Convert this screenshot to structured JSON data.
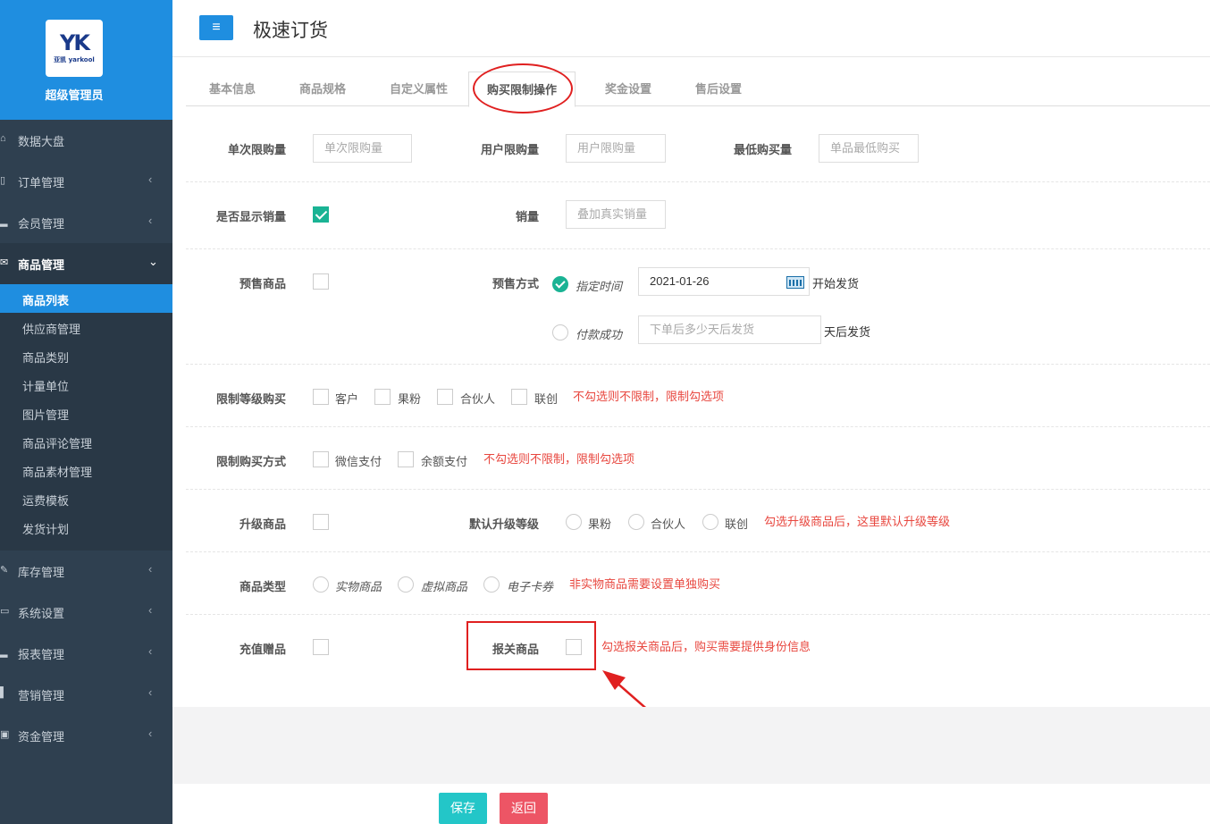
{
  "sidebar": {
    "brand_mark": "YK",
    "brand_text": "亚凯 yarkool",
    "admin_label": "超级管理员",
    "items": [
      {
        "label": "数据大盘",
        "icon": "home-icon"
      },
      {
        "label": "订单管理",
        "icon": "order-icon"
      },
      {
        "label": "会员管理",
        "icon": "bar-chart-icon"
      },
      {
        "label": "商品管理",
        "icon": "envelope-icon"
      },
      {
        "label": "库存管理",
        "icon": "edit-icon"
      },
      {
        "label": "系统设置",
        "icon": "monitor-icon"
      },
      {
        "label": "报表管理",
        "icon": "bar-chart-icon"
      },
      {
        "label": "营销管理",
        "icon": "bars-icon"
      },
      {
        "label": "资金管理",
        "icon": "money-icon"
      }
    ],
    "sub_items": [
      "商品列表",
      "供应商管理",
      "商品类别",
      "计量单位",
      "图片管理",
      "商品评论管理",
      "商品素材管理",
      "运费模板",
      "发货计划"
    ],
    "active_sub": "商品列表"
  },
  "header": {
    "menu_icon": "≡",
    "title": "极速订货"
  },
  "tabs": [
    "基本信息",
    "商品规格",
    "自定义属性",
    "购买限制操作",
    "奖金设置",
    "售后设置"
  ],
  "active_tab": "购买限制操作",
  "form": {
    "single_limit": {
      "label": "单次限购量",
      "placeholder": "单次限购量"
    },
    "user_limit": {
      "label": "用户限购量",
      "placeholder": "用户限购量"
    },
    "min_purchase": {
      "label": "最低购买量",
      "placeholder": "单品最低购买"
    },
    "show_sales": {
      "label": "是否显示销量",
      "checked": true
    },
    "sales": {
      "label": "销量",
      "placeholder": "叠加真实销量"
    },
    "presale": {
      "label": "预售商品",
      "checked": false
    },
    "presale_mode": {
      "label": "预售方式",
      "option1": "指定时间",
      "date_value": "2021-01-26",
      "option1_suffix": "开始发货",
      "option2": "付款成功",
      "days_placeholder": "下单后多少天后发货",
      "option2_suffix": "天后发货"
    },
    "level_limit": {
      "label": "限制等级购买",
      "options": [
        "客户",
        "果粉",
        "合伙人",
        "联创"
      ],
      "hint": "不勾选则不限制，限制勾选项"
    },
    "pay_limit": {
      "label": "限制购买方式",
      "options": [
        "微信支付",
        "余额支付"
      ],
      "hint": "不勾选则不限制，限制勾选项"
    },
    "upgrade": {
      "label": "升级商品",
      "checked": false
    },
    "default_level": {
      "label": "默认升级等级",
      "options": [
        "果粉",
        "合伙人",
        "联创"
      ],
      "hint": "勾选升级商品后，这里默认升级等级"
    },
    "goods_type": {
      "label": "商品类型",
      "options": [
        "实物商品",
        "虚拟商品",
        "电子卡券"
      ],
      "hint": "非实物商品需要设置单独购买"
    },
    "recharge_gift": {
      "label": "充值赠品",
      "checked": false
    },
    "customs": {
      "label": "报关商品",
      "checked": false,
      "hint": "勾选报关商品后，购买需要提供身份信息"
    }
  },
  "buttons": {
    "save": "保存",
    "back": "返回"
  },
  "colors": {
    "brand_blue": "#1f8ee0",
    "sidebar_bg": "#2f4050",
    "accent_green": "#1ab394",
    "save_btn": "#23c6c8",
    "back_btn": "#ed5565",
    "annotation_red": "#e02020",
    "hint_red": "#e8473f"
  }
}
